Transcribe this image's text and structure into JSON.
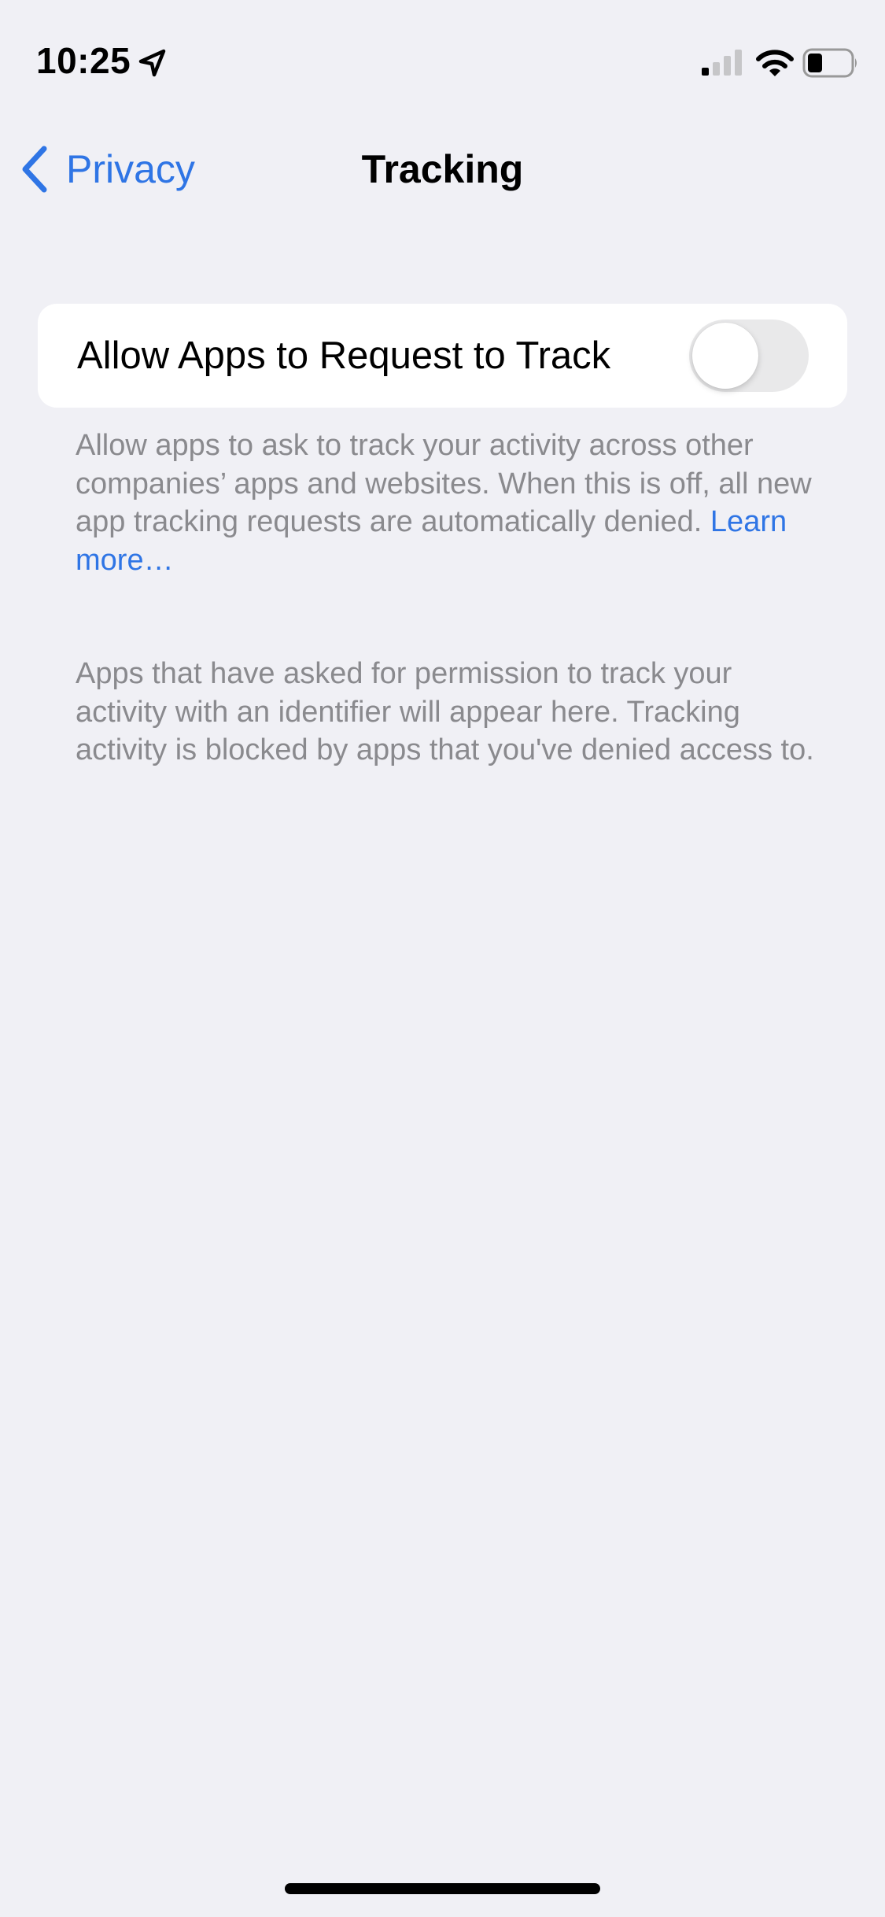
{
  "status_bar": {
    "time": "10:25",
    "icons": [
      "location-arrow-icon",
      "cellular-signal-icon",
      "wifi-icon",
      "battery-icon"
    ]
  },
  "nav": {
    "back_label": "Privacy",
    "title": "Tracking"
  },
  "settings": {
    "allow_tracking_label": "Allow Apps to Request to Track",
    "allow_tracking_enabled": false
  },
  "footer": {
    "description": "Allow apps to ask to track your activity across other companies’ apps and websites. When this is off, all new app tracking requests are automatically denied.",
    "learn_more": "Learn more…",
    "apps_info": "Apps that have asked for permission to track your activity with an identifier will appear here. Tracking activity is blocked by apps that you've denied access to."
  },
  "colors": {
    "accent": "#2f75e5",
    "background": "#f0f0f5",
    "secondary_text": "#8a8a8e",
    "toggle_off": "#e9e9ea"
  }
}
